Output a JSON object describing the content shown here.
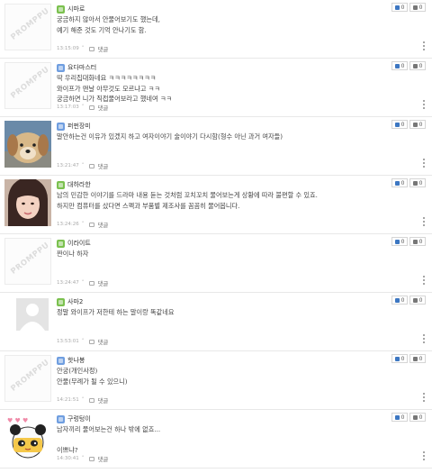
{
  "reply_label": "댓글",
  "logo_text": "PROMPPU",
  "comments": [
    {
      "nick": "시마로",
      "level": "green",
      "avatar": "logo-avatar",
      "lines": [
        "궁금하지 않아서 안물어보기도 했는데,",
        "예기 해준 것도 기억 안나기도 함."
      ],
      "time": "13:15:09",
      "up": "0",
      "down": "0"
    },
    {
      "nick": "요다마스터",
      "level": "blue",
      "avatar": "logo-avatar",
      "lines": [
        "딱 우리집대화네요 ㅋㅋㅋㅋㅋㅋㅋㅋ",
        "와이프가 맨날 아무것도 모르냐고 ㅋㅋ",
        "궁금하면 니가 직접물어보라고 했네여 ㅋㅋ"
      ],
      "time": "13:17:03",
      "up": "0",
      "down": "0"
    },
    {
      "nick": "퍼펀장미",
      "level": "blue",
      "avatar": "puppy-photo-avatar",
      "lines": [
        "말안하는건 이유가 있겠지 하고 여자이야기 술이야기 다시함(형수 아닌 과거 여자들)"
      ],
      "time": "13:21:47",
      "up": "0",
      "down": "0"
    },
    {
      "nick": "대하라한",
      "level": "green",
      "avatar": "woman-photo-avatar",
      "lines": [
        "남의 민감한 이야기를 드라마 내용 듣는 것처럼 꼬치꼬치 물어보는게 상황에 따라 불편할 수 있죠.",
        "하지만 컴퓨터를 샀다면 스펙과 부품별 제조사를 꼼꼼히 물어봅니다."
      ],
      "time": "13:24:26",
      "up": "0",
      "down": "0"
    },
    {
      "nick": "이라이트",
      "level": "green",
      "avatar": "logo-avatar",
      "lines": [
        "짠이나 하자"
      ],
      "time": "13:24:47",
      "up": "0",
      "down": "0"
    },
    {
      "nick": "사마2",
      "level": "green",
      "avatar": "default-person-avatar",
      "lines": [
        "정말 와이프가 저한테 하는 말이랑 똑같네요"
      ],
      "time": "13:53:01",
      "up": "0",
      "down": "0"
    },
    {
      "nick": "핫나봉",
      "level": "blue",
      "avatar": "logo-avatar",
      "lines": [
        "안궁(개인사정)",
        "안물(무례가 될 수 있으니)"
      ],
      "time": "14:21:51",
      "up": "0",
      "down": "0"
    },
    {
      "nick": "구렁텅이",
      "level": "blue",
      "avatar": "panda-character-avatar",
      "lines": [
        "남자끼리 물어보는건 하나 밖에 없죠...",
        "",
        "이쁘냐?"
      ],
      "time": "14:30:41",
      "up": "0",
      "down": "0"
    }
  ]
}
